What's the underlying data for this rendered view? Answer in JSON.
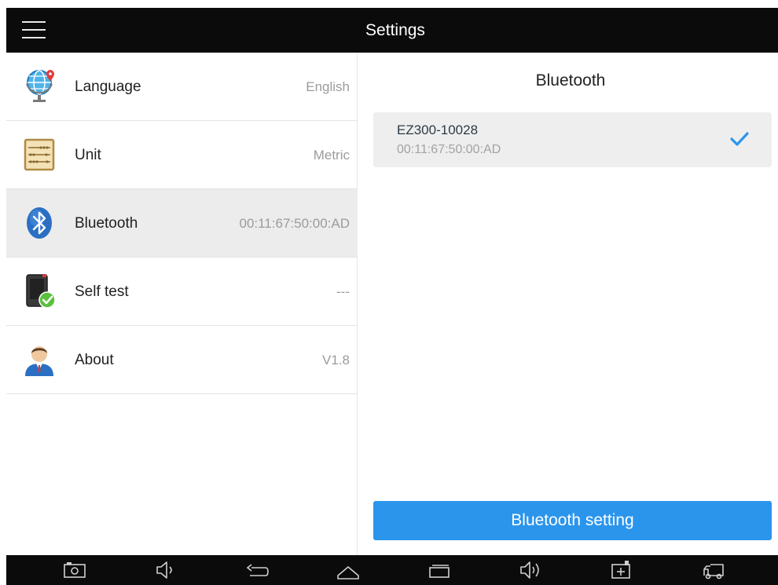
{
  "header": {
    "title": "Settings",
    "menu_icon": "hamburger-menu-icon"
  },
  "settings": {
    "items": [
      {
        "icon": "globe-pin-icon",
        "label": "Language",
        "value": "English"
      },
      {
        "icon": "abacus-icon",
        "label": "Unit",
        "value": "Metric"
      },
      {
        "icon": "bluetooth-icon",
        "label": "Bluetooth",
        "value": "00:11:67:50:00:AD",
        "selected": true
      },
      {
        "icon": "device-check-icon",
        "label": "Self test",
        "value": "---"
      },
      {
        "icon": "user-avatar-icon",
        "label": "About",
        "value": "V1.8"
      }
    ]
  },
  "bluetooth_panel": {
    "title": "Bluetooth",
    "device": {
      "name": "EZ300-10028",
      "address": "00:11:67:50:00:AD",
      "connected_icon": "checkmark-icon"
    },
    "setting_button": "Bluetooth setting"
  },
  "navbar": {
    "icons": [
      "screenshot-icon",
      "volume-down-icon",
      "back-icon",
      "home-icon",
      "recent-apps-icon",
      "volume-up-icon",
      "battery-charge-icon",
      "vci-truck-icon"
    ]
  },
  "colors": {
    "accent": "#2b95ec",
    "bar": "#0b0b0b",
    "selected_row": "#ececec"
  }
}
